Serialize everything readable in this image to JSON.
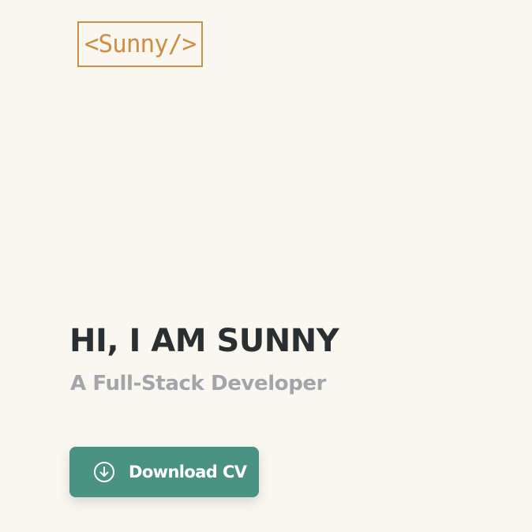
{
  "header": {
    "logo_text": "<Sunny/>"
  },
  "hero": {
    "title": "HI, I AM SUNNY",
    "subtitle": "A Full-Stack Developer",
    "cta": {
      "label": "Download CV",
      "icon": "download-circle-icon"
    }
  },
  "colors": {
    "background": "#faf7f1",
    "accent": "#cf8e45",
    "button": "#4a9282",
    "title": "#2a3031",
    "subtitle": "#a3a5ab"
  }
}
